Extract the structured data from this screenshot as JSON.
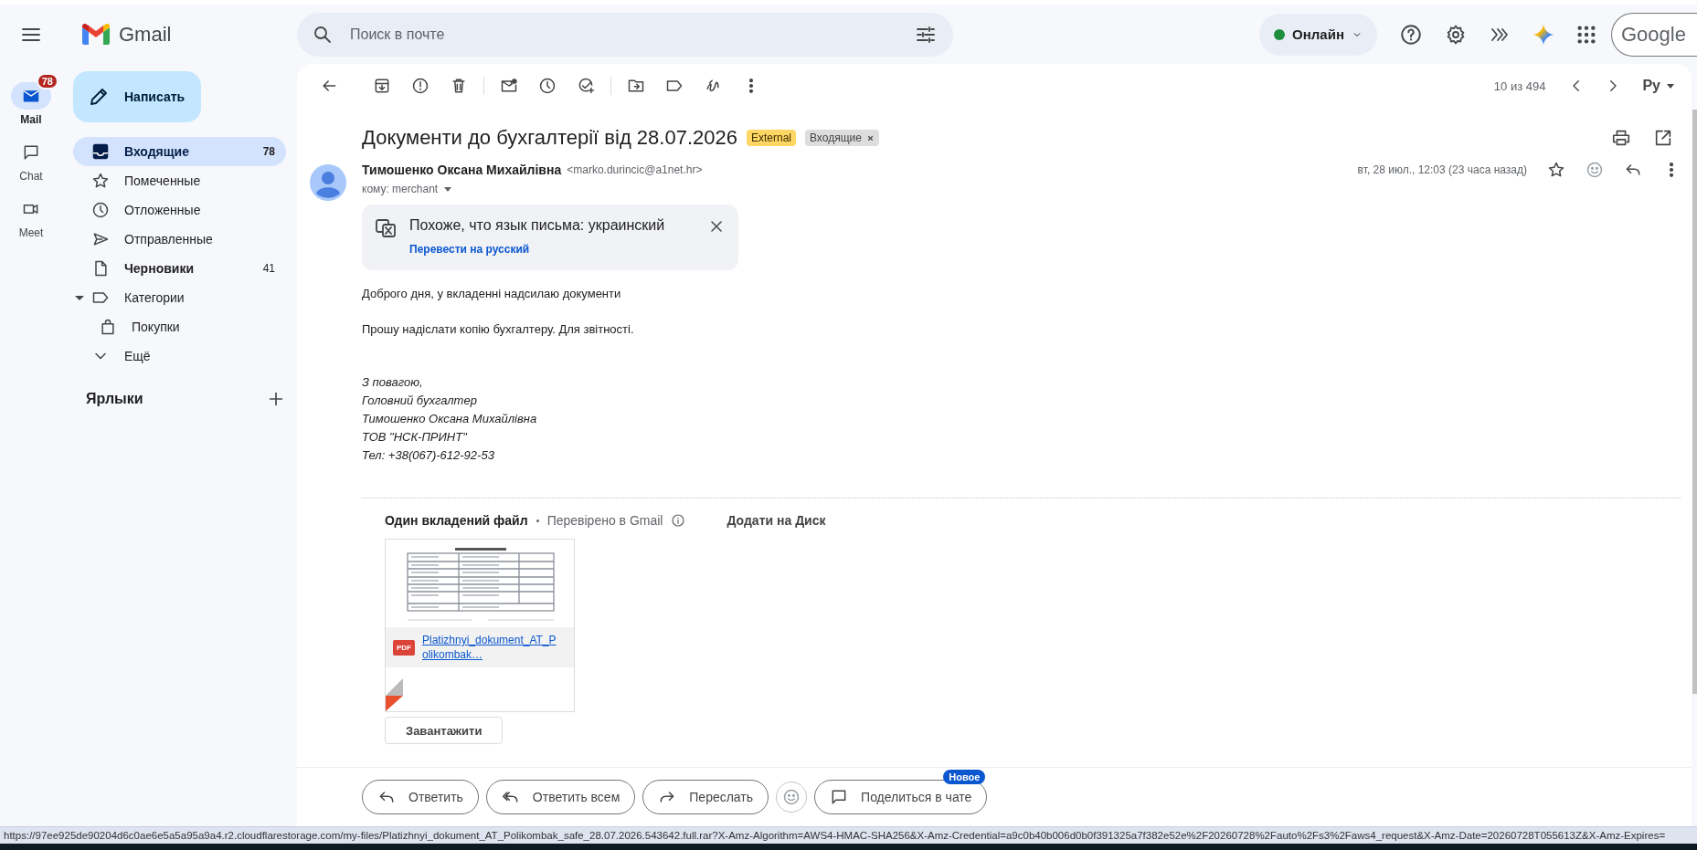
{
  "app": {
    "name": "Gmail"
  },
  "rail": [
    {
      "kind": "mail",
      "label": "Mail",
      "selected": true,
      "badge": "78"
    },
    {
      "kind": "chat",
      "label": "Chat",
      "selected": false
    },
    {
      "kind": "meet",
      "label": "Meet",
      "selected": false
    }
  ],
  "compose": {
    "label": "Написать"
  },
  "search": {
    "placeholder": "Поиск в почте"
  },
  "status": {
    "label": "Онлайн"
  },
  "account": {
    "label": "Google"
  },
  "folders": [
    {
      "kind": "inbox",
      "label": "Входящие",
      "count": "78",
      "selected": true,
      "unread": true
    },
    {
      "kind": "starred",
      "label": "Помеченные",
      "selected": false,
      "unread": false
    },
    {
      "kind": "snoozed",
      "label": "Отложенные",
      "selected": false,
      "unread": false
    },
    {
      "kind": "sent",
      "label": "Отправленные",
      "selected": false,
      "unread": false
    },
    {
      "kind": "drafts",
      "label": "Черновики",
      "count": "41",
      "selected": false,
      "unread": true
    },
    {
      "kind": "category",
      "label": "Категории",
      "selected": false,
      "unread": false,
      "expanded": true,
      "children": [
        {
          "kind": "shopping",
          "label": "Покупки",
          "selected": false,
          "unread": false
        }
      ]
    },
    {
      "kind": "more",
      "label": "Ещё",
      "selected": false,
      "unread": false
    }
  ],
  "labels_heading": "Ярлыки",
  "pager": {
    "text": "10 из 494",
    "language": "Ру"
  },
  "message": {
    "subject": "Документи до бухгалтерії від 28.07.2026",
    "tags": [
      {
        "kind": "external",
        "label": "External"
      },
      {
        "kind": "label",
        "label": "Входящие",
        "removable": true
      }
    ],
    "sender_name": "Тимошенко Оксана Михайлівна",
    "sender_email": "<marko.durincic@a1net.hr>",
    "to": "кому: merchant",
    "date": "вт, 28 июл., 12:03 (23 часа назад)",
    "translate": {
      "text": "Похоже, что язык письма: украинский",
      "link": "Перевести на русский"
    },
    "body": [
      "Доброго дня, у вкладенні надсилаю документи",
      "Прошу надіслати копію бухгалтеру. Для звітності."
    ],
    "signature": [
      "З повагою,",
      "Головний бухгалтер",
      "Тимошенко Оксана Михайлівна",
      "ТОВ \"НСК-ПРИНТ\"",
      "Тел: +38(067)-612-92-53"
    ],
    "attachments": {
      "heading": "Один вкладений файл",
      "verified": "Перевірено в Gmail",
      "add_to_drive": "Додати на Диск",
      "files": [
        {
          "type": "PDF",
          "name": "Platizhnyi_dokument_AT_Polikombak…",
          "download": "Завантажити"
        }
      ]
    }
  },
  "reply_actions": [
    {
      "kind": "reply",
      "label": "Ответить"
    },
    {
      "kind": "reply_all",
      "label": "Ответить всем"
    },
    {
      "kind": "forward",
      "label": "Переслать"
    }
  ],
  "share": {
    "label": "Поделиться в чате",
    "badge": "Новое"
  },
  "status_bar": "https://97ee925de90204d6c0ae6e5a5a95a9a4.r2.cloudflarestorage.com/my-files/Platizhnyi_dokument_AT_Polikombak_safe_28.07.2026.543642.full.rar?X-Amz-Algorithm=AWS4-HMAC-SHA256&X-Amz-Credential=a9c0b40b006d0b0f391325a7f382e52e%2F20260728%2Fauto%2Fs3%2Faws4_request&X-Amz-Date=20260728T055613Z&X-Amz-Expires="
}
